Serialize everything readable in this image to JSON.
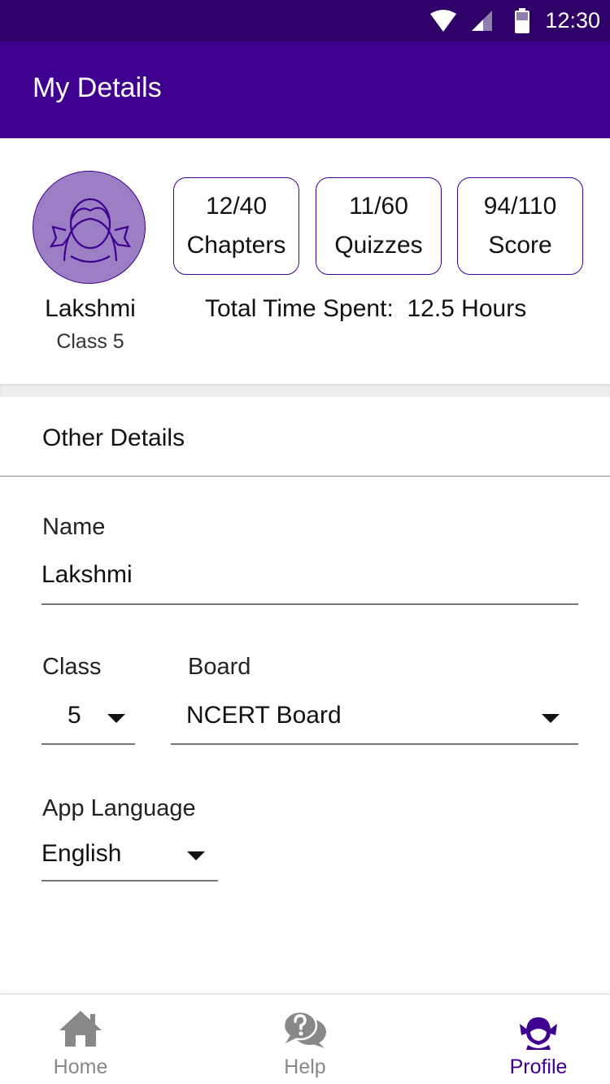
{
  "status_bar": {
    "time": "12:30",
    "icons": [
      "wifi-icon",
      "cell-signal-icon",
      "battery-icon"
    ]
  },
  "app_bar": {
    "title": "My Details"
  },
  "profile": {
    "name": "Lakshmi",
    "class_label": "Class 5",
    "avatar_icon": "girl-avatar-icon",
    "stats": [
      {
        "value": "12/40",
        "label": "Chapters"
      },
      {
        "value": "11/60",
        "label": "Quizzes"
      },
      {
        "value": "94/110",
        "label": "Score"
      }
    ],
    "time_spent_text": "Total Time Spent:  12.5 Hours"
  },
  "other_details": {
    "title": "Other Details",
    "name_field": {
      "label": "Name",
      "value": "Lakshmi"
    },
    "class_field": {
      "label": "Class",
      "value": "5"
    },
    "board_field": {
      "label": "Board",
      "value": "NCERT Board"
    },
    "language_field": {
      "label": "App Language",
      "value": "English"
    }
  },
  "bottom_nav": {
    "items": [
      {
        "label": "Home",
        "icon": "home-icon",
        "active": false
      },
      {
        "label": "Help",
        "icon": "help-chat-icon",
        "active": false
      },
      {
        "label": "Profile",
        "icon": "profile-girl-icon",
        "active": true
      }
    ]
  },
  "colors": {
    "status_bar": "#2e0068",
    "primary": "#3f0090",
    "avatar_fill": "#9c7ec4",
    "inactive_nav": "#888888"
  }
}
